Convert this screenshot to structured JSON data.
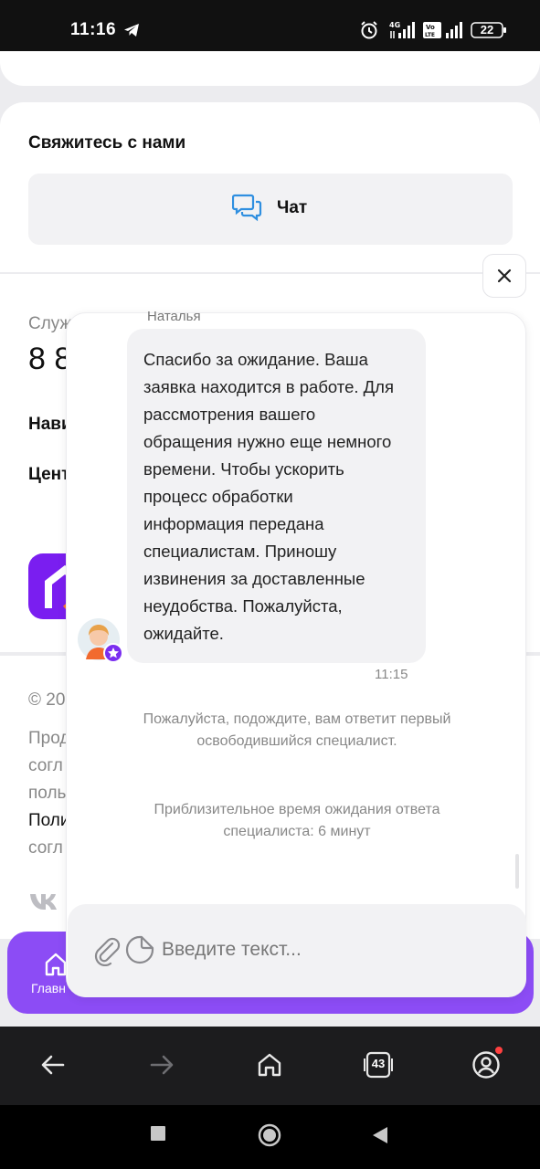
{
  "status_bar": {
    "time": "11:16",
    "battery": "22",
    "icons": [
      "telegram-icon",
      "alarm-icon",
      "signal-4g-icon",
      "volte-icon",
      "signal-icon",
      "battery-icon"
    ]
  },
  "page": {
    "contact_title": "Свяжитесь с нами",
    "chat_button_label": "Чат",
    "service_label": "Служ",
    "phone": "8 8",
    "nav_label": "Нави",
    "center_label": "Цент",
    "copyright": "© 20",
    "footer_lines": [
      "Прод",
      "согл",
      "поль",
      "Поли",
      "согл"
    ],
    "bottom_nav_home": "Главн"
  },
  "chat": {
    "agent_name": "Наталья",
    "message": "Спасибо за ожидание. Ваша\nзаявка находится в работе. Для\nрассмотрения вашего\nобращения нужно еще немного\nвремени. Чтобы ускорить\nпроцесс обработки\nинформация передана\nспециалистам. Приношу\nизвинения за доставленные\nнеудобства. Пожалуйста,\nожидайте.",
    "message_time": "11:15",
    "system_message_1": "Пожалуйста, подождите, вам ответит первый\nосвободившийся специалист.",
    "system_message_2": "Приблизительное время ожидания ответа\nспециалиста: 6 минут",
    "input_placeholder": "Введите текст..."
  },
  "browser_bar": {
    "tabs_count": "43"
  },
  "colors": {
    "accent": "#8c4cf5",
    "logo": "#7a1ef0",
    "chat_icon": "#2f8fe0"
  }
}
